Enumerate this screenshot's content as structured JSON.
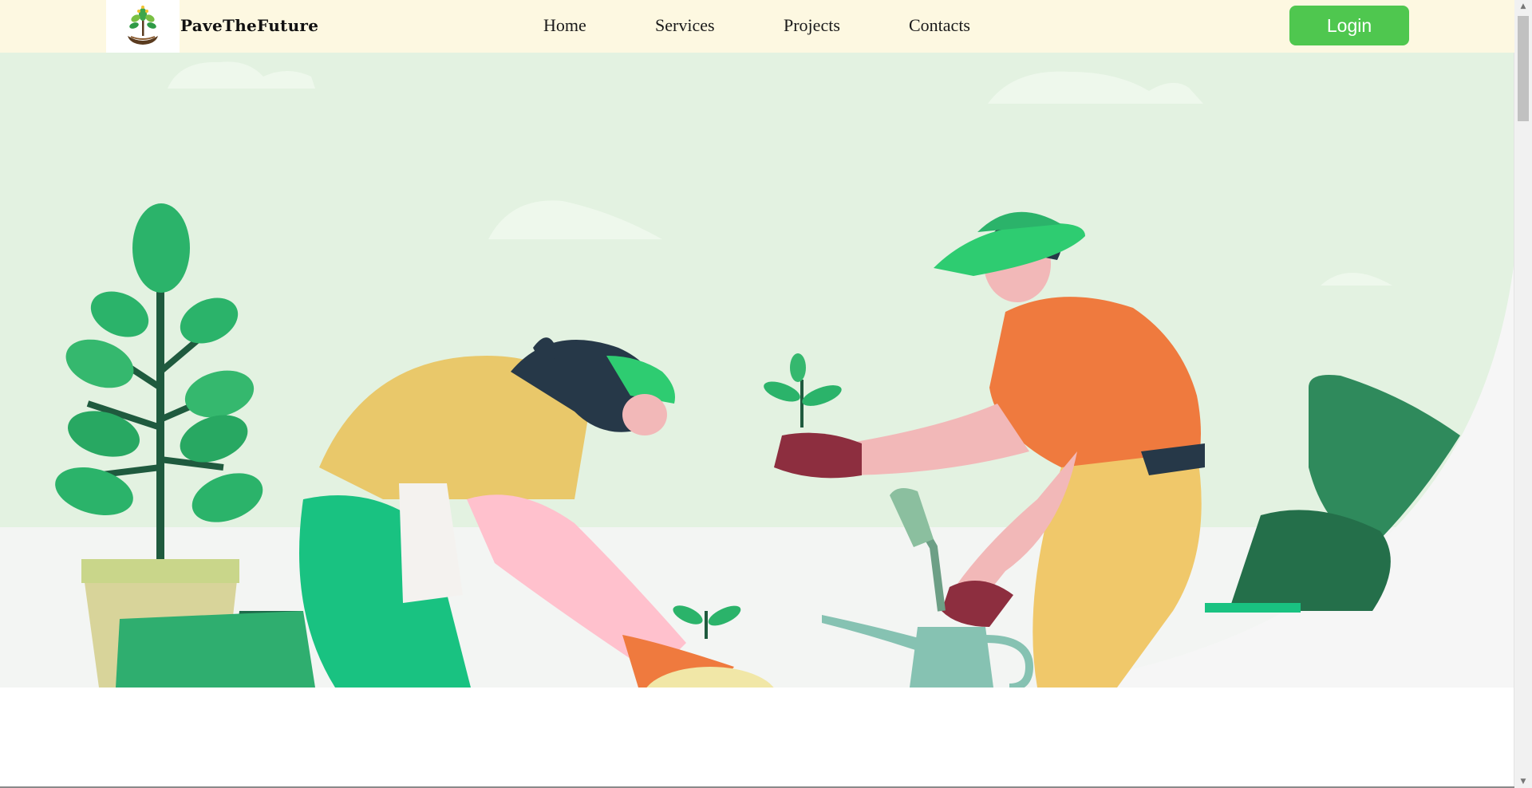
{
  "brand": {
    "name": "PaveTheFuture",
    "logo_icon": "tree-in-hand-icon"
  },
  "nav": {
    "items": [
      {
        "label": "Home"
      },
      {
        "label": "Services"
      },
      {
        "label": "Projects"
      },
      {
        "label": "Contacts"
      }
    ]
  },
  "login": {
    "label": "Login"
  },
  "hero": {
    "illustration": "two-gardeners-planting-seedlings"
  },
  "colors": {
    "navbar_bg": "#fdf8e1",
    "login_bg": "#4fc74f",
    "hero_sky": "#e3f2e1",
    "ground": "#f6f6f6"
  }
}
